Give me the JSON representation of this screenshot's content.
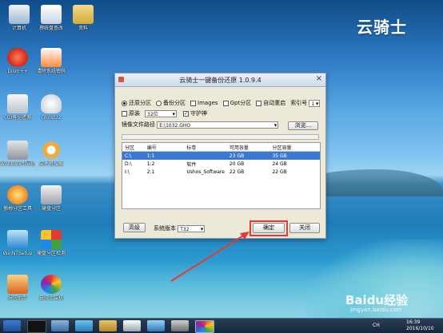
{
  "desktop": {
    "logo_text": "云骑士",
    "icons": [
      {
        "label": "计算机",
        "color": "#dfe8f3"
      },
      {
        "label": "理统盘查改",
        "color": "#ffffff"
      },
      {
        "label": "资料",
        "color": "#e6c36a"
      },
      {
        "label": "Dism++",
        "color": "#e04030"
      },
      {
        "label": "清除系统密码",
        "color": "#ff6a2b"
      },
      {
        "label": "CGI备份还原",
        "color": "#e9ecef"
      },
      {
        "label": "Ghost32",
        "color": "#f2f2f2"
      },
      {
        "label": "Windows引导修复",
        "color": "#bfc6cf"
      },
      {
        "label": "文件名搜索",
        "color": "#f0b44c"
      },
      {
        "label": "WinNTSetup",
        "color": "#3aa5e6"
      },
      {
        "label": "硬盘分区检测",
        "color": "#8cc63f"
      },
      {
        "label": "傲梅分区工具",
        "color": "#e8f0f7"
      },
      {
        "label": "硬盘分区",
        "color": "#d9d9d9"
      },
      {
        "label": "分区助手",
        "color": "#e57a2b"
      },
      {
        "label": "云骑士装机",
        "color": "#d94a5a"
      }
    ]
  },
  "window": {
    "title": "云骑士一键备份还原 1.0.9.4",
    "radio_restore": "还原分区",
    "radio_backup": "备份分区",
    "chk_images": "Images",
    "chk_gpt": "Gpt分区",
    "chk_autoreboot": "自动重启",
    "index_label": "索引号",
    "index_value": "1",
    "chk_original": "原装",
    "bits_value": "32位",
    "chk_guard": "守护神",
    "image_path_label": "镜像文件路径",
    "image_path_value": "E:\\1032.GHO",
    "browse_button": "浏览...",
    "table": {
      "headers": [
        "分区",
        "编号",
        "标卷",
        "可用容量",
        "分区容量"
      ],
      "rows": [
        [
          "C:\\",
          "1:1",
          "",
          "23 GB",
          "35 GB"
        ],
        [
          "D:\\",
          "1:2",
          "软件",
          "20 GB",
          "24 GB"
        ],
        [
          "I:\\",
          "2:1",
          "Ushos_Software",
          "22 GB",
          "22 GB"
        ]
      ]
    },
    "advanced_button": "高级",
    "sys_version_label": "系统版本",
    "sys_version_value": "T32",
    "ok_button": "确定",
    "close_button": "关闭"
  },
  "taskbar": {
    "time": "16:39",
    "date": "2016/10/10",
    "lang": "CH"
  },
  "watermark": {
    "brand": "Baidu经验",
    "url": "jingyan.baidu.com"
  }
}
